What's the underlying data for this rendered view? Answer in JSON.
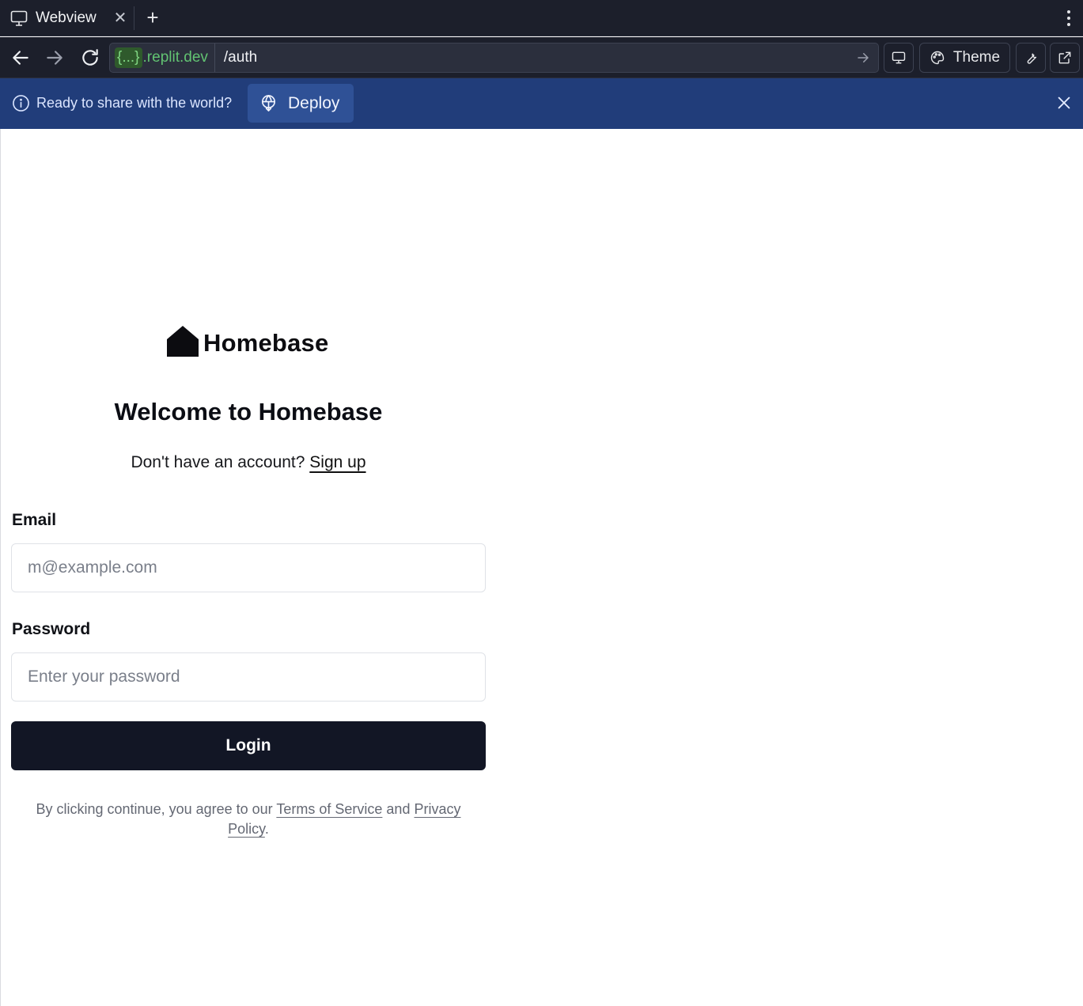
{
  "browser": {
    "tab": {
      "title": "Webview"
    },
    "url": {
      "host_badge": "{...}",
      "host": ".replit.dev",
      "path": "/auth"
    },
    "toolbar": {
      "theme_label": "Theme"
    }
  },
  "banner": {
    "message": "Ready to share with the world?",
    "deploy_label": "Deploy",
    "background": "#213d7a"
  },
  "page": {
    "brand": "Homebase",
    "heading": "Welcome to Homebase",
    "signup_prompt": "Don't have an account?",
    "signup_link": "Sign up",
    "email": {
      "label": "Email",
      "placeholder": "m@example.com",
      "value": ""
    },
    "password": {
      "label": "Password",
      "placeholder": "Enter your password",
      "value": ""
    },
    "login_label": "Login",
    "legal": {
      "prefix": "By clicking continue, you agree to our",
      "terms": "Terms of Service",
      "and": "and",
      "privacy": "Privacy Policy",
      "suffix": "."
    },
    "colors": {
      "primary_button": "#121625",
      "text": "#0b0d14"
    }
  },
  "icons": {
    "tab": "monitor-icon",
    "close": "close-icon",
    "new_tab": "plus-icon",
    "menu": "kebab-menu-icon",
    "back": "arrow-left-icon",
    "forward": "arrow-right-icon",
    "reload": "reload-icon",
    "go": "arrow-right-icon",
    "device": "monitor-icon",
    "theme": "palette-icon",
    "devtools": "wrench-icon",
    "open_external": "external-link-icon",
    "info": "info-icon",
    "deploy": "deploy-icon",
    "logo": "house-icon"
  }
}
